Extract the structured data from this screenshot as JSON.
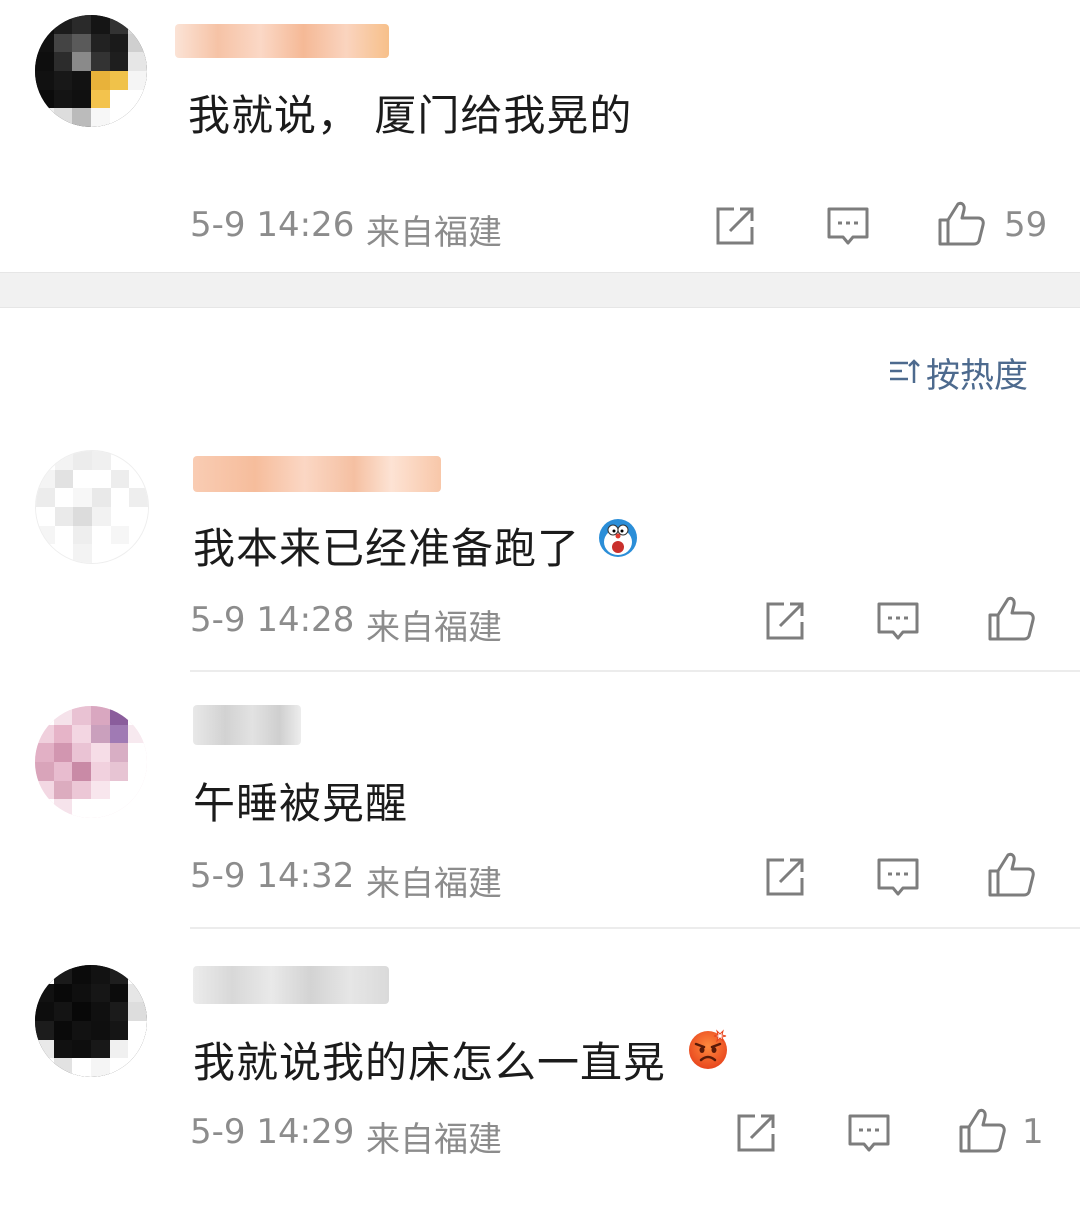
{
  "top_comment": {
    "text": "我就说， 厦门给我晃的",
    "time": "5-9 14:26",
    "location": "来自福建",
    "likes": "59"
  },
  "sort": {
    "label": "按热度",
    "icon": "sort-icon"
  },
  "replies": [
    {
      "text": "我本来已经准备跑了",
      "emoji": "doraemon-shocked-emoji",
      "time": "5-9 14:28",
      "location": "来自福建",
      "likes": ""
    },
    {
      "text": "午睡被晃醒",
      "emoji": "",
      "time": "5-9 14:32",
      "location": "来自福建",
      "likes": ""
    },
    {
      "text": "我就说我的床怎么一直晃",
      "emoji": "angry-face-emoji",
      "time": "5-9 14:29",
      "location": "来自福建",
      "likes": "1"
    }
  ],
  "icons": {
    "share": "share-icon",
    "comment": "comment-icon",
    "like": "thumb-up-icon"
  },
  "colors": {
    "meta": "#8c8c8c",
    "sort": "#4d6a8e",
    "band": "#f1f1f1"
  }
}
